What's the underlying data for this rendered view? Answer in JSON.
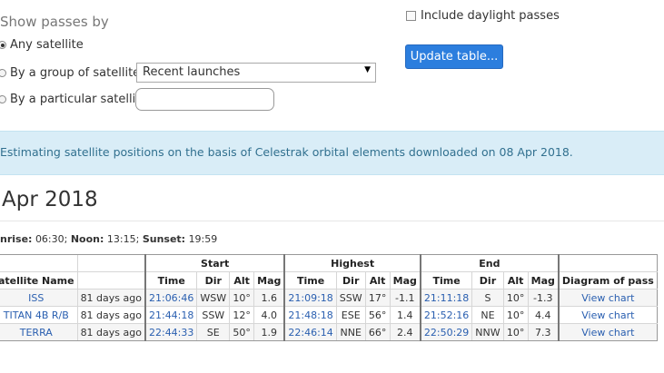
{
  "form": {
    "heading": "Show passes by",
    "options": [
      {
        "label": "Any satellite",
        "checked": true
      },
      {
        "label": "By a group of satellites:",
        "checked": false
      },
      {
        "label": "By a particular satellite:",
        "checked": false
      }
    ],
    "group_select_value": "Recent launches",
    "satellite_input_value": "",
    "daylight_label": "Include daylight passes",
    "daylight_checked": false,
    "update_button": "Update table..."
  },
  "info": "Estimating satellite positions on the basis of Celestrak orbital elements downloaded on 08 Apr 2018.",
  "date_heading": "Apr 2018",
  "sun": {
    "sunrise_label": "nrise:",
    "sunrise": "06:30;",
    "noon_label": "Noon:",
    "noon": "13:15;",
    "sunset_label": "Sunset:",
    "sunset": "19:59"
  },
  "table": {
    "groups": [
      "Start",
      "Highest",
      "End"
    ],
    "col_sat": "atellite Name",
    "sub_headers": [
      "Time",
      "Dir",
      "Alt",
      "Mag"
    ],
    "col_diagram": "Diagram of pass",
    "rows": [
      {
        "name": "ISS",
        "age": "81 days ago",
        "start": [
          "21:06:46",
          "WSW",
          "10°",
          "1.6"
        ],
        "high": [
          "21:09:18",
          "SSW",
          "17°",
          "-1.1"
        ],
        "end": [
          "21:11:18",
          "S",
          "10°",
          "-1.3"
        ],
        "chart": "View chart"
      },
      {
        "name": "TITAN 4B R/B",
        "age": "81 days ago",
        "start": [
          "21:44:18",
          "SSW",
          "12°",
          "4.0"
        ],
        "high": [
          "21:48:18",
          "ESE",
          "56°",
          "1.4"
        ],
        "end": [
          "21:52:16",
          "NE",
          "10°",
          "4.4"
        ],
        "chart": "View chart"
      },
      {
        "name": "TERRA",
        "age": "81 days ago",
        "start": [
          "22:44:33",
          "SE",
          "50°",
          "1.9"
        ],
        "high": [
          "22:46:14",
          "NNE",
          "66°",
          "2.4"
        ],
        "end": [
          "22:50:29",
          "NNW",
          "10°",
          "7.3"
        ],
        "chart": "View chart"
      }
    ]
  }
}
